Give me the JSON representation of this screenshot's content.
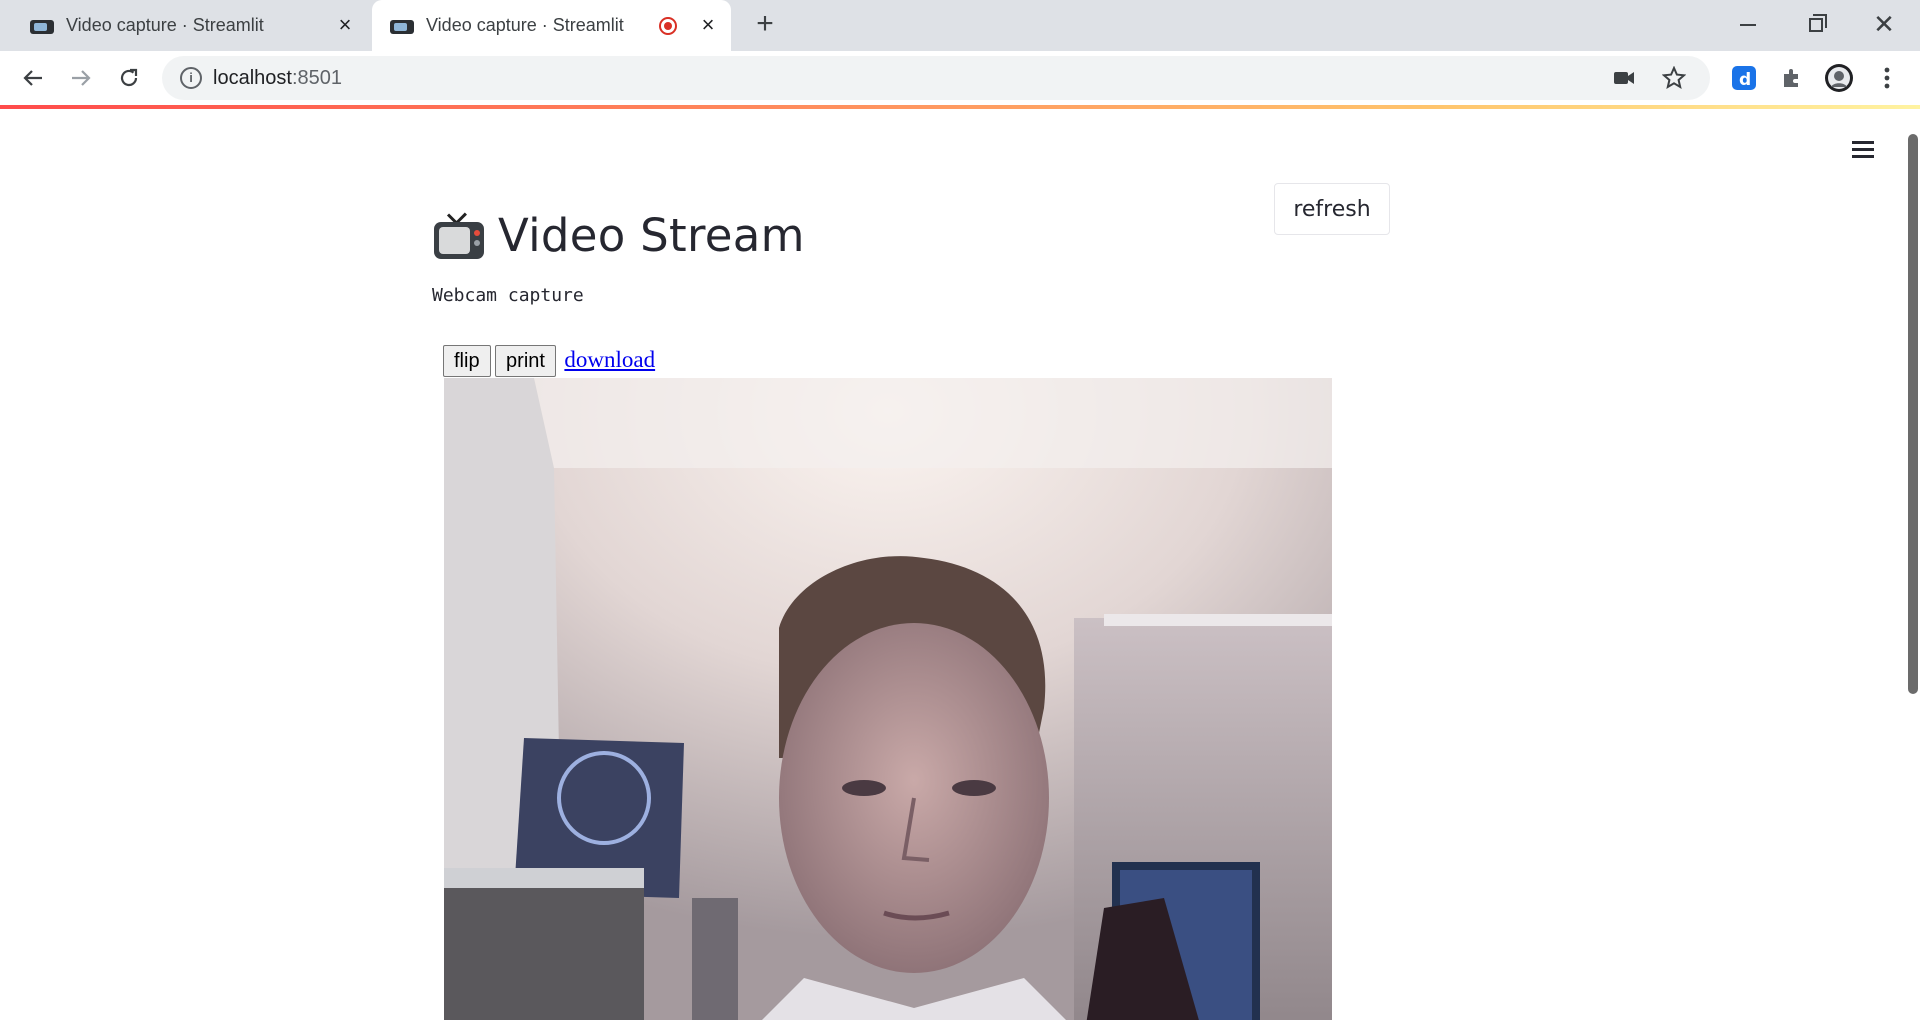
{
  "browser": {
    "tabs": [
      {
        "title": "Video capture · Streamlit",
        "active": false
      },
      {
        "title": "Video capture · Streamlit",
        "active": true,
        "recording": true
      }
    ],
    "new_tab_icon": "plus-icon",
    "window_controls": [
      "minimize-icon",
      "restore-icon",
      "close-icon"
    ],
    "nav": [
      "back-arrow-icon",
      "forward-arrow-icon",
      "reload-icon"
    ],
    "url_host": "localhost",
    "url_port": ":8501",
    "omnibox_icons": [
      "camera-icon",
      "star-icon"
    ],
    "extensions": [
      "d-extension-icon",
      "puzzle-extensions-icon",
      "profile-avatar-icon",
      "kebab-menu-icon"
    ]
  },
  "app": {
    "refresh_label": "refresh",
    "title": "Video Stream",
    "title_icon": "tv-icon",
    "caption": "Webcam capture",
    "component": {
      "flip_label": "flip",
      "print_label": "print",
      "download_label": "download"
    },
    "menu_icon": "hamburger-menu-icon"
  },
  "colors": {
    "tabstrip": "#dee1e6",
    "recording": "#d93025",
    "link": "#0000ee",
    "decoration_start": "#ff4b4b",
    "decoration_end": "#fff3a1"
  }
}
